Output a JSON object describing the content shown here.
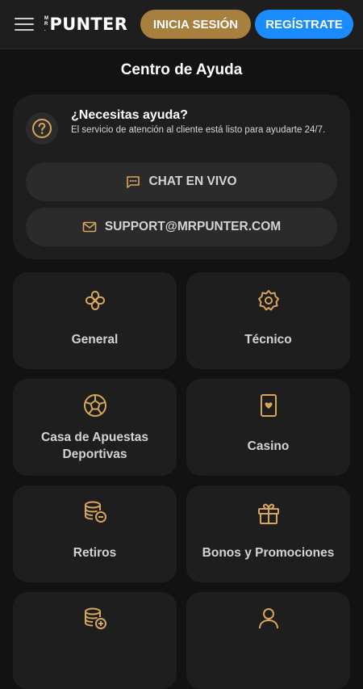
{
  "header": {
    "logo_prefix": "MR.",
    "logo_text": "PUNTER",
    "login_label": "INICIA SESIÓN",
    "register_label": "REGÍSTRATE"
  },
  "page": {
    "title": "Centro de Ayuda"
  },
  "help": {
    "heading": "¿Necesitas ayuda?",
    "description": "El servicio de atención al cliente está listo para ayudarte 24/7.",
    "chat_label": "CHAT EN VIVO",
    "email_label": "SUPPORT@MRPUNTER.COM",
    "icons": {
      "help": "question-icon",
      "chat": "chat-bubble-icon",
      "email": "envelope-icon"
    }
  },
  "categories": [
    {
      "label": "General",
      "icon": "clover-icon"
    },
    {
      "label": "Técnico",
      "icon": "gear-icon"
    },
    {
      "label": "Casa de Apuestas Deportivas",
      "icon": "soccer-ball-icon"
    },
    {
      "label": "Casino",
      "icon": "playing-card-icon"
    },
    {
      "label": "Retiros",
      "icon": "coins-minus-icon"
    },
    {
      "label": "Bonos y Promociones",
      "icon": "gift-icon"
    },
    {
      "label": "",
      "icon": "coins-plus-icon"
    },
    {
      "label": "",
      "icon": "user-icon"
    }
  ],
  "colors": {
    "background": "#121212",
    "card": "#1e1e1e",
    "pill": "#2b2b2b",
    "gold": "#d9a55a",
    "login_button": "#a77f3f",
    "register_button": "#1a8cff"
  }
}
